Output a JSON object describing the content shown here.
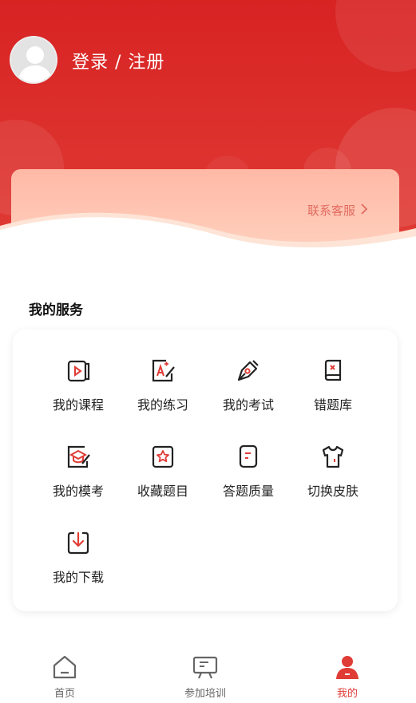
{
  "colors": {
    "brand": "#d82323",
    "accent": "#e03c36",
    "promo": "#ffc6b3",
    "link": "#e26b60"
  },
  "header": {
    "login_label": "登录 / 注册",
    "avatar_icon": "user-avatar-icon"
  },
  "promo": {
    "contact_label": "联系客服",
    "chevron_icon": "chevron-right-icon"
  },
  "services": {
    "title": "我的服务",
    "items": [
      {
        "label": "我的课程",
        "icon": "course-video-icon"
      },
      {
        "label": "我的练习",
        "icon": "practice-edit-icon"
      },
      {
        "label": "我的考试",
        "icon": "exam-pen-icon"
      },
      {
        "label": "错题库",
        "icon": "wrong-book-icon"
      },
      {
        "label": "我的模考",
        "icon": "mock-exam-cap-icon"
      },
      {
        "label": "收藏题目",
        "icon": "favorite-star-icon"
      },
      {
        "label": "答题质量",
        "icon": "answer-quality-icon"
      },
      {
        "label": "切换皮肤",
        "icon": "skin-shirt-icon"
      },
      {
        "label": "我的下载",
        "icon": "download-icon"
      }
    ]
  },
  "tabbar": {
    "items": [
      {
        "label": "首页",
        "icon": "home-icon",
        "active": false
      },
      {
        "label": "参加培训",
        "icon": "training-board-icon",
        "active": false
      },
      {
        "label": "我的",
        "icon": "profile-icon",
        "active": true
      }
    ]
  }
}
